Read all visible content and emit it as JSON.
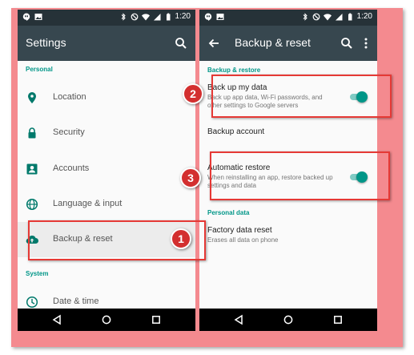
{
  "status_bar": {
    "time": "1:20"
  },
  "settings_screen": {
    "title": "Settings",
    "sections": {
      "personal": "Personal",
      "system": "System"
    },
    "items": {
      "location": "Location",
      "security": "Security",
      "accounts": "Accounts",
      "language": "Language & input",
      "backup": "Backup & reset",
      "datetime": "Date & time"
    }
  },
  "backup_screen": {
    "title": "Backup & reset",
    "sections": {
      "backup_restore": "Backup & restore",
      "personal_data": "Personal data"
    },
    "backup_data": {
      "title": "Back up my data",
      "subtitle": "Back up app data, Wi-Fi passwords, and other settings to Google servers",
      "enabled": true
    },
    "backup_account": {
      "title": "Backup account"
    },
    "auto_restore": {
      "title": "Automatic restore",
      "subtitle": "When reinstalling an app, restore backed up settings and data",
      "enabled": true
    },
    "factory_reset": {
      "title": "Factory data reset",
      "subtitle": "Erases all data on phone"
    }
  },
  "step_badges": {
    "step1": "1",
    "step2": "2",
    "step3": "3"
  },
  "colors": {
    "accent": "#009688",
    "appbar": "#37474f",
    "statusbar": "#263238",
    "highlight": "#e53935",
    "frame": "#f48a8f"
  }
}
